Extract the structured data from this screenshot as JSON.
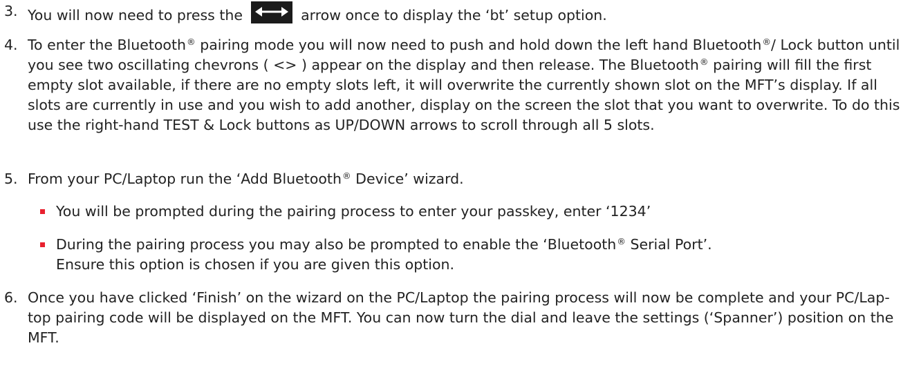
{
  "steps": [
    {
      "number": "3.",
      "text_before": "You will now need to press the",
      "key_icon": "left-right-arrow-key-icon",
      "text_after": "arrow once to display the ‘bt’ setup option."
    },
    {
      "number": "4.",
      "parts": [
        "To enter the Bluetooth",
        "®",
        " pairing mode you will now need to push and hold down the left hand Bluetooth",
        "®",
        "/ Lock button until you see two oscillating chevrons ( <> ) appear on the display and then release. The Bluetooth",
        "®",
        " pairing will fill the first empty slot available, if there are no empty slots left, it will overwrite the currently shown slot on the MFT’s display.  If all slots are currently in use and you wish to add another, display on the screen the slot that you want to overwrite. To do this use the right-hand TEST & Lock buttons as UP/DOWN arrows to scroll through all 5 slots."
      ]
    },
    {
      "number": "5.",
      "parts": [
        "From your PC/Laptop run the ‘Add Bluetooth",
        "®",
        " Device’ wizard."
      ],
      "bullets": [
        {
          "parts": [
            "You will be prompted during the pairing process to enter your passkey, enter ‘1234’"
          ]
        },
        {
          "parts": [
            "During the pairing process you may also be prompted to enable the ‘Bluetooth",
            "®",
            " Serial Port’."
          ],
          "line2": "Ensure this option is chosen if you are given this option."
        }
      ]
    },
    {
      "number": "6.",
      "text": "Once you have clicked ‘Finish’ on the wizard on the PC/Laptop the pairing process will now be complete and your PC/Lap-top pairing code will be displayed on the MFT.  You can now turn the dial and leave the settings (‘Spanner’) position on the MFT."
    }
  ],
  "colors": {
    "text": "#222222",
    "bullet": "#e8212f",
    "key_bg": "#1b1b1b",
    "key_arrow": "#ffffff"
  }
}
